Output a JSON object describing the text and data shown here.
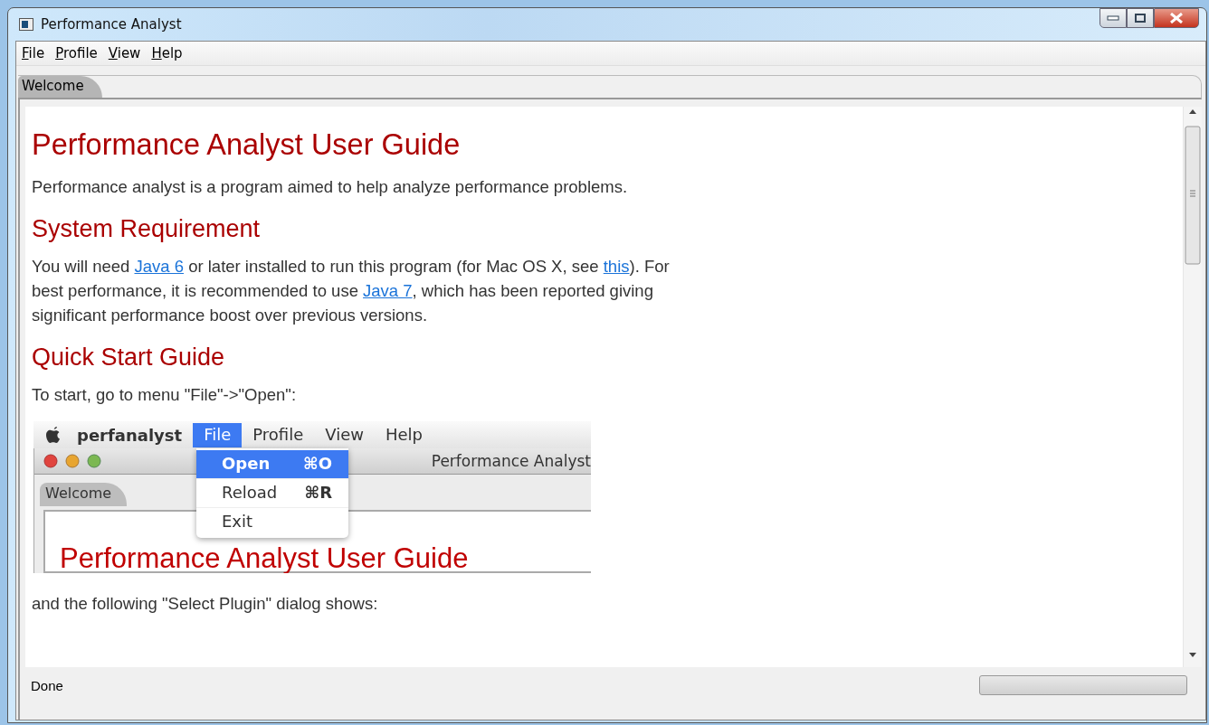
{
  "window": {
    "title": "Performance Analyst"
  },
  "menu_bar": [
    {
      "label": "File"
    },
    {
      "label": "Profile"
    },
    {
      "label": "View"
    },
    {
      "label": "Help"
    }
  ],
  "tabs": [
    {
      "label": "Welcome",
      "selected": true
    }
  ],
  "document": [
    {
      "kind": "title",
      "text": "Performance Analyst User Guide"
    },
    {
      "kind": "paragraph",
      "segments": [
        {
          "text": "Performance analyst is a program aimed to help analyze performance problems."
        }
      ]
    },
    {
      "kind": "heading",
      "text": "System Requirement"
    },
    {
      "kind": "paragraph",
      "segments": [
        {
          "text": "You will need "
        },
        {
          "link": "Java 6"
        },
        {
          "text": " or later installed to run this program (for Mac OS X, see "
        },
        {
          "link": "this"
        },
        {
          "text": "). For best performance, it is recommended to use "
        },
        {
          "link": "Java 7"
        },
        {
          "text": ", which has been reported giving significant performance boost over previous versions."
        }
      ]
    },
    {
      "kind": "heading",
      "text": "Quick Start Guide"
    },
    {
      "kind": "paragraph",
      "segments": [
        {
          "text": "To start, go to menu \"File\"->\"Open\":"
        }
      ]
    },
    {
      "kind": "screenshot",
      "app": "perfanalyst",
      "menu": [
        {
          "label": "File",
          "selected": true
        },
        {
          "label": "Profile",
          "selected": false
        },
        {
          "label": "View",
          "selected": false
        },
        {
          "label": "Help",
          "selected": false
        }
      ],
      "window_title": "Performance Analyst",
      "tab": "Welcome",
      "heading": "Performance Analyst User Guide",
      "dropdown": [
        {
          "label": "Open",
          "shortcut": "⌘O",
          "selected": true
        },
        {
          "label": "Reload",
          "shortcut": "⌘R",
          "selected": false
        },
        {
          "label": "Exit",
          "selected": false
        }
      ]
    },
    {
      "kind": "paragraph",
      "segments": [
        {
          "text": "and the following \"Select Plugin\" dialog shows:"
        }
      ]
    }
  ],
  "status_bar": {
    "text": "Done",
    "progress": {
      "level": 0
    }
  }
}
